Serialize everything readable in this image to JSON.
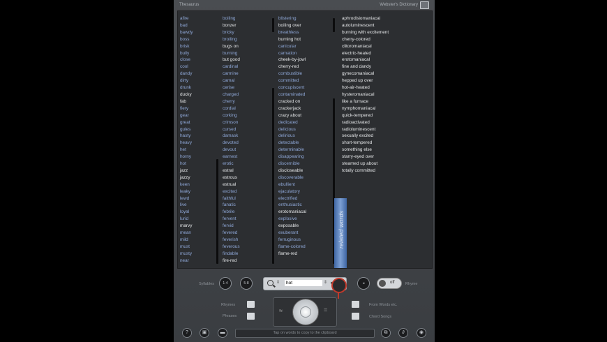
{
  "header": {
    "left_title": "Thesaurus",
    "right_title": "Webster's Dictionary"
  },
  "columns": [
    {
      "words": [
        {
          "t": "afire",
          "c": "blue"
        },
        {
          "t": "bad",
          "c": "blue"
        },
        {
          "t": "bawdy",
          "c": "blue"
        },
        {
          "t": "boss",
          "c": "blue"
        },
        {
          "t": "brisk",
          "c": "blue"
        },
        {
          "t": "bully",
          "c": "blue"
        },
        {
          "t": "close",
          "c": "blue"
        },
        {
          "t": "cool",
          "c": "blue"
        },
        {
          "t": "dandy",
          "c": "blue"
        },
        {
          "t": "dirty",
          "c": "blue"
        },
        {
          "t": "drunk",
          "c": "blue"
        },
        {
          "t": "ducky",
          "c": "white"
        },
        {
          "t": "fab",
          "c": "white"
        },
        {
          "t": "fiery",
          "c": "blue"
        },
        {
          "t": "gear",
          "c": "blue"
        },
        {
          "t": "great",
          "c": "blue"
        },
        {
          "t": "gules",
          "c": "blue"
        },
        {
          "t": "hasty",
          "c": "blue"
        },
        {
          "t": "heavy",
          "c": "blue"
        },
        {
          "t": "het",
          "c": "blue"
        },
        {
          "t": "horny",
          "c": "blue"
        },
        {
          "t": "hot",
          "c": "blue"
        },
        {
          "t": "jazz",
          "c": "white"
        },
        {
          "t": "jazzy",
          "c": "white"
        },
        {
          "t": "keen",
          "c": "blue"
        },
        {
          "t": "leaky",
          "c": "blue"
        },
        {
          "t": "lewd",
          "c": "blue"
        },
        {
          "t": "live",
          "c": "blue"
        },
        {
          "t": "loyal",
          "c": "blue"
        },
        {
          "t": "lurid",
          "c": "blue"
        },
        {
          "t": "marvy",
          "c": "white"
        },
        {
          "t": "mean",
          "c": "blue"
        },
        {
          "t": "mild",
          "c": "blue"
        },
        {
          "t": "must",
          "c": "blue"
        },
        {
          "t": "musty",
          "c": "blue"
        },
        {
          "t": "near",
          "c": "blue"
        }
      ]
    },
    {
      "words": [
        {
          "t": "boiling",
          "c": "blue"
        },
        {
          "t": "bonzer",
          "c": "white"
        },
        {
          "t": "bricky",
          "c": "blue"
        },
        {
          "t": "broiling",
          "c": "blue"
        },
        {
          "t": "bugs on",
          "c": "white"
        },
        {
          "t": "burning",
          "c": "blue"
        },
        {
          "t": "but good",
          "c": "white"
        },
        {
          "t": "cardinal",
          "c": "blue"
        },
        {
          "t": "carmine",
          "c": "blue"
        },
        {
          "t": "carnal",
          "c": "blue"
        },
        {
          "t": "cerise",
          "c": "blue"
        },
        {
          "t": "charged",
          "c": "blue"
        },
        {
          "t": "cherry",
          "c": "blue"
        },
        {
          "t": "cordial",
          "c": "blue"
        },
        {
          "t": "corking",
          "c": "blue"
        },
        {
          "t": "crimson",
          "c": "blue"
        },
        {
          "t": "cursed",
          "c": "blue"
        },
        {
          "t": "damask",
          "c": "blue"
        },
        {
          "t": "devoted",
          "c": "blue"
        },
        {
          "t": "devout",
          "c": "blue"
        },
        {
          "t": "earnest",
          "c": "blue"
        },
        {
          "t": "erotic",
          "c": "blue"
        },
        {
          "t": "estral",
          "c": "white"
        },
        {
          "t": "estrous",
          "c": "white"
        },
        {
          "t": "estrual",
          "c": "white"
        },
        {
          "t": "excited",
          "c": "blue"
        },
        {
          "t": "faithful",
          "c": "blue"
        },
        {
          "t": "fanatic",
          "c": "blue"
        },
        {
          "t": "febrile",
          "c": "blue"
        },
        {
          "t": "fervent",
          "c": "blue"
        },
        {
          "t": "fervid",
          "c": "blue"
        },
        {
          "t": "fevered",
          "c": "blue"
        },
        {
          "t": "feverish",
          "c": "blue"
        },
        {
          "t": "feverous",
          "c": "blue"
        },
        {
          "t": "findable",
          "c": "blue"
        },
        {
          "t": "fire-red",
          "c": "white"
        }
      ]
    },
    {
      "words": [
        {
          "t": "blistering",
          "c": "blue"
        },
        {
          "t": "boiling over",
          "c": "white"
        },
        {
          "t": "breathless",
          "c": "blue"
        },
        {
          "t": "burning hot",
          "c": "white"
        },
        {
          "t": "canicular",
          "c": "blue"
        },
        {
          "t": "carnation",
          "c": "blue"
        },
        {
          "t": "cheek-by-jowl",
          "c": "white"
        },
        {
          "t": "cherry-red",
          "c": "white"
        },
        {
          "t": "combustible",
          "c": "blue"
        },
        {
          "t": "committed",
          "c": "blue"
        },
        {
          "t": "concupiscent",
          "c": "blue"
        },
        {
          "t": "contaminated",
          "c": "blue"
        },
        {
          "t": "cracked on",
          "c": "white"
        },
        {
          "t": "crackerjack",
          "c": "white"
        },
        {
          "t": "crazy about",
          "c": "white"
        },
        {
          "t": "dedicated",
          "c": "blue"
        },
        {
          "t": "delicious",
          "c": "blue"
        },
        {
          "t": "delirious",
          "c": "blue"
        },
        {
          "t": "detectable",
          "c": "blue"
        },
        {
          "t": "determinable",
          "c": "blue"
        },
        {
          "t": "disappearing",
          "c": "blue"
        },
        {
          "t": "discernible",
          "c": "blue"
        },
        {
          "t": "discloseable",
          "c": "white"
        },
        {
          "t": "discoverable",
          "c": "blue"
        },
        {
          "t": "ebullient",
          "c": "blue"
        },
        {
          "t": "ejaculatory",
          "c": "blue"
        },
        {
          "t": "electrified",
          "c": "blue"
        },
        {
          "t": "enthusiastic",
          "c": "blue"
        },
        {
          "t": "erotomaniacal",
          "c": "white"
        },
        {
          "t": "explosive",
          "c": "blue"
        },
        {
          "t": "exposable",
          "c": "white"
        },
        {
          "t": "exuberant",
          "c": "blue"
        },
        {
          "t": "ferruginous",
          "c": "blue"
        },
        {
          "t": "flame-colored",
          "c": "blue"
        },
        {
          "t": "flame-red",
          "c": "white"
        }
      ]
    },
    {
      "words": [
        {
          "t": "aphrodisiomaniacal",
          "c": "white"
        },
        {
          "t": "autoluminescent",
          "c": "white"
        },
        {
          "t": "burning with excitement",
          "c": "white"
        },
        {
          "t": "cherry-colored",
          "c": "white"
        },
        {
          "t": "clitoromaniacal",
          "c": "white"
        },
        {
          "t": "electric-heated",
          "c": "white"
        },
        {
          "t": "erotomaniacal",
          "c": "white"
        },
        {
          "t": "fine and dandy",
          "c": "white"
        },
        {
          "t": "gynecomaniacal",
          "c": "white"
        },
        {
          "t": "hepped up over",
          "c": "white"
        },
        {
          "t": "hot-air-heated",
          "c": "white"
        },
        {
          "t": "hysteromaniacal",
          "c": "white"
        },
        {
          "t": "like a furnace",
          "c": "white"
        },
        {
          "t": "nymphomaniacal",
          "c": "white"
        },
        {
          "t": "quick-tempered",
          "c": "white"
        },
        {
          "t": "radioactivated",
          "c": "white"
        },
        {
          "t": "radioluminescent",
          "c": "white"
        },
        {
          "t": "sexually excited",
          "c": "white"
        },
        {
          "t": "short-tempered",
          "c": "white"
        },
        {
          "t": "something else",
          "c": "white"
        },
        {
          "t": "starry-eyed over",
          "c": "white"
        },
        {
          "t": "steamed up about",
          "c": "white"
        },
        {
          "t": "totally committed",
          "c": "white"
        }
      ]
    }
  ],
  "related_label": "related words",
  "controls": {
    "syllables_label": "Syllables",
    "syl_btn1": "1-4",
    "syl_btn2": "5-8",
    "search_value": "hot",
    "back_btn": "",
    "rhyme_label": "Rhyme",
    "rhyme_toggle": "off",
    "rhymes_left_label": "Rhymes",
    "phrases_label": "Phrases",
    "from_label": "From Words etc.",
    "chord_label": "Chord Songs",
    "status_text": "Tap on words to copy to the clipboard"
  },
  "icons": [
    "question-icon",
    "lock-icon",
    "menu-icon",
    "copy-icon",
    "link-icon",
    "eye-icon"
  ]
}
